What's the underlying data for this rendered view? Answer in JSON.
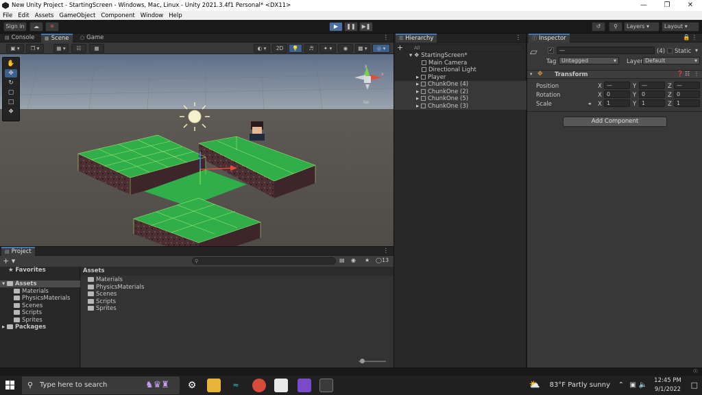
{
  "window": {
    "title": "New Unity Project - StartingScreen - Windows, Mac, Linux - Unity 2021.3.4f1 Personal* <DX11>"
  },
  "menu": [
    "File",
    "Edit",
    "Assets",
    "GameObject",
    "Component",
    "Window",
    "Help"
  ],
  "toolbar": {
    "sign_in": "Sign in",
    "layers": "Layers",
    "layout": "Layout"
  },
  "scene_tabs": [
    {
      "label": "Console"
    },
    {
      "label": "Scene",
      "selected": true
    },
    {
      "label": "Game"
    }
  ],
  "scene_toolbar": {
    "mode_2d": "2D"
  },
  "project": {
    "title": "Project",
    "favorites": "Favorites",
    "assets": "Assets",
    "tree": [
      "Materials",
      "PhysicsMaterials",
      "Scenes",
      "Scripts",
      "Sprites"
    ],
    "packages": "Packages",
    "breadcrumb": "Assets",
    "files": [
      "Materials",
      "PhysicsMaterials",
      "Scenes",
      "Scripts",
      "Sprites"
    ],
    "hidden_count": "13"
  },
  "hierarchy": {
    "title": "Hierarchy",
    "search_placeholder": "All",
    "scene": "StartingScreen*",
    "items": [
      "Main Camera",
      "Directional Light",
      "Player",
      "ChunkOne (4)",
      "ChunkOne (2)",
      "ChunkOne (5)",
      "ChunkOne (3)"
    ]
  },
  "inspector": {
    "title": "Inspector",
    "name_value": "—",
    "count": "(4)",
    "static_label": "Static",
    "tag_label": "Tag",
    "tag_value": "Untagged",
    "layer_label": "Layer",
    "layer_value": "Default",
    "component": "Transform",
    "position_label": "Position",
    "rotation_label": "Rotation",
    "scale_label": "Scale",
    "axis": {
      "x": "X",
      "y": "Y",
      "z": "Z"
    },
    "position": {
      "x": "—",
      "y": "—",
      "z": "—"
    },
    "rotation": {
      "x": "0",
      "y": "0",
      "z": "0"
    },
    "scale": {
      "x": "1",
      "y": "1",
      "z": "1"
    },
    "add_component": "Add Component"
  },
  "gizmo": {
    "persp_label": "Iso",
    "y_label": "y",
    "x_label": "x"
  },
  "taskbar": {
    "search_placeholder": "Type here to search",
    "weather": "83°F  Partly sunny",
    "time": "12:45 PM",
    "date": "9/1/2022"
  },
  "colors": {
    "grass": "#2fae4a",
    "grass_top": "#3ec25a",
    "dirt": "#4d3236",
    "grid_line": "#b7f070",
    "accent": "#4a6fa5",
    "sky": "#6d7d94",
    "ground": "#5a5650"
  }
}
